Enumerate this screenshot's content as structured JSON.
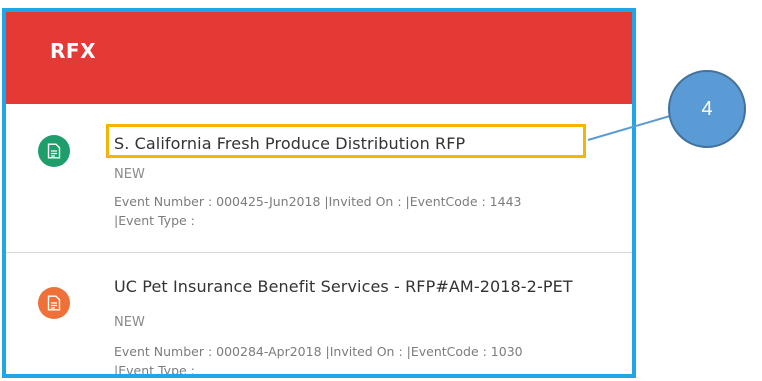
{
  "panel": {
    "title": "RFX",
    "header_color": "#e53935",
    "border_color": "#1ea6e9"
  },
  "items": [
    {
      "title": "S. California Fresh Produce Distribution RFP",
      "status": "NEW",
      "details_line1": "Event Number : 000425-Jun2018 |Invited On : |EventCode : 1443",
      "details_line2": "|Event Type :",
      "icon": "document-icon",
      "icon_color": "#1e9e6a"
    },
    {
      "title": "UC Pet Insurance Benefit Services - RFP#AM-2018-2-PET",
      "status": "NEW",
      "details_line1": "Event Number : 000284-Apr2018 |Invited On : |EventCode : 1030",
      "details_line2": "|Event Type :",
      "icon": "document-icon",
      "icon_color": "#f0703a"
    }
  ],
  "annotation": {
    "number": "4",
    "highlight_color": "#f4b400",
    "callout_color": "#5b9bd5"
  }
}
